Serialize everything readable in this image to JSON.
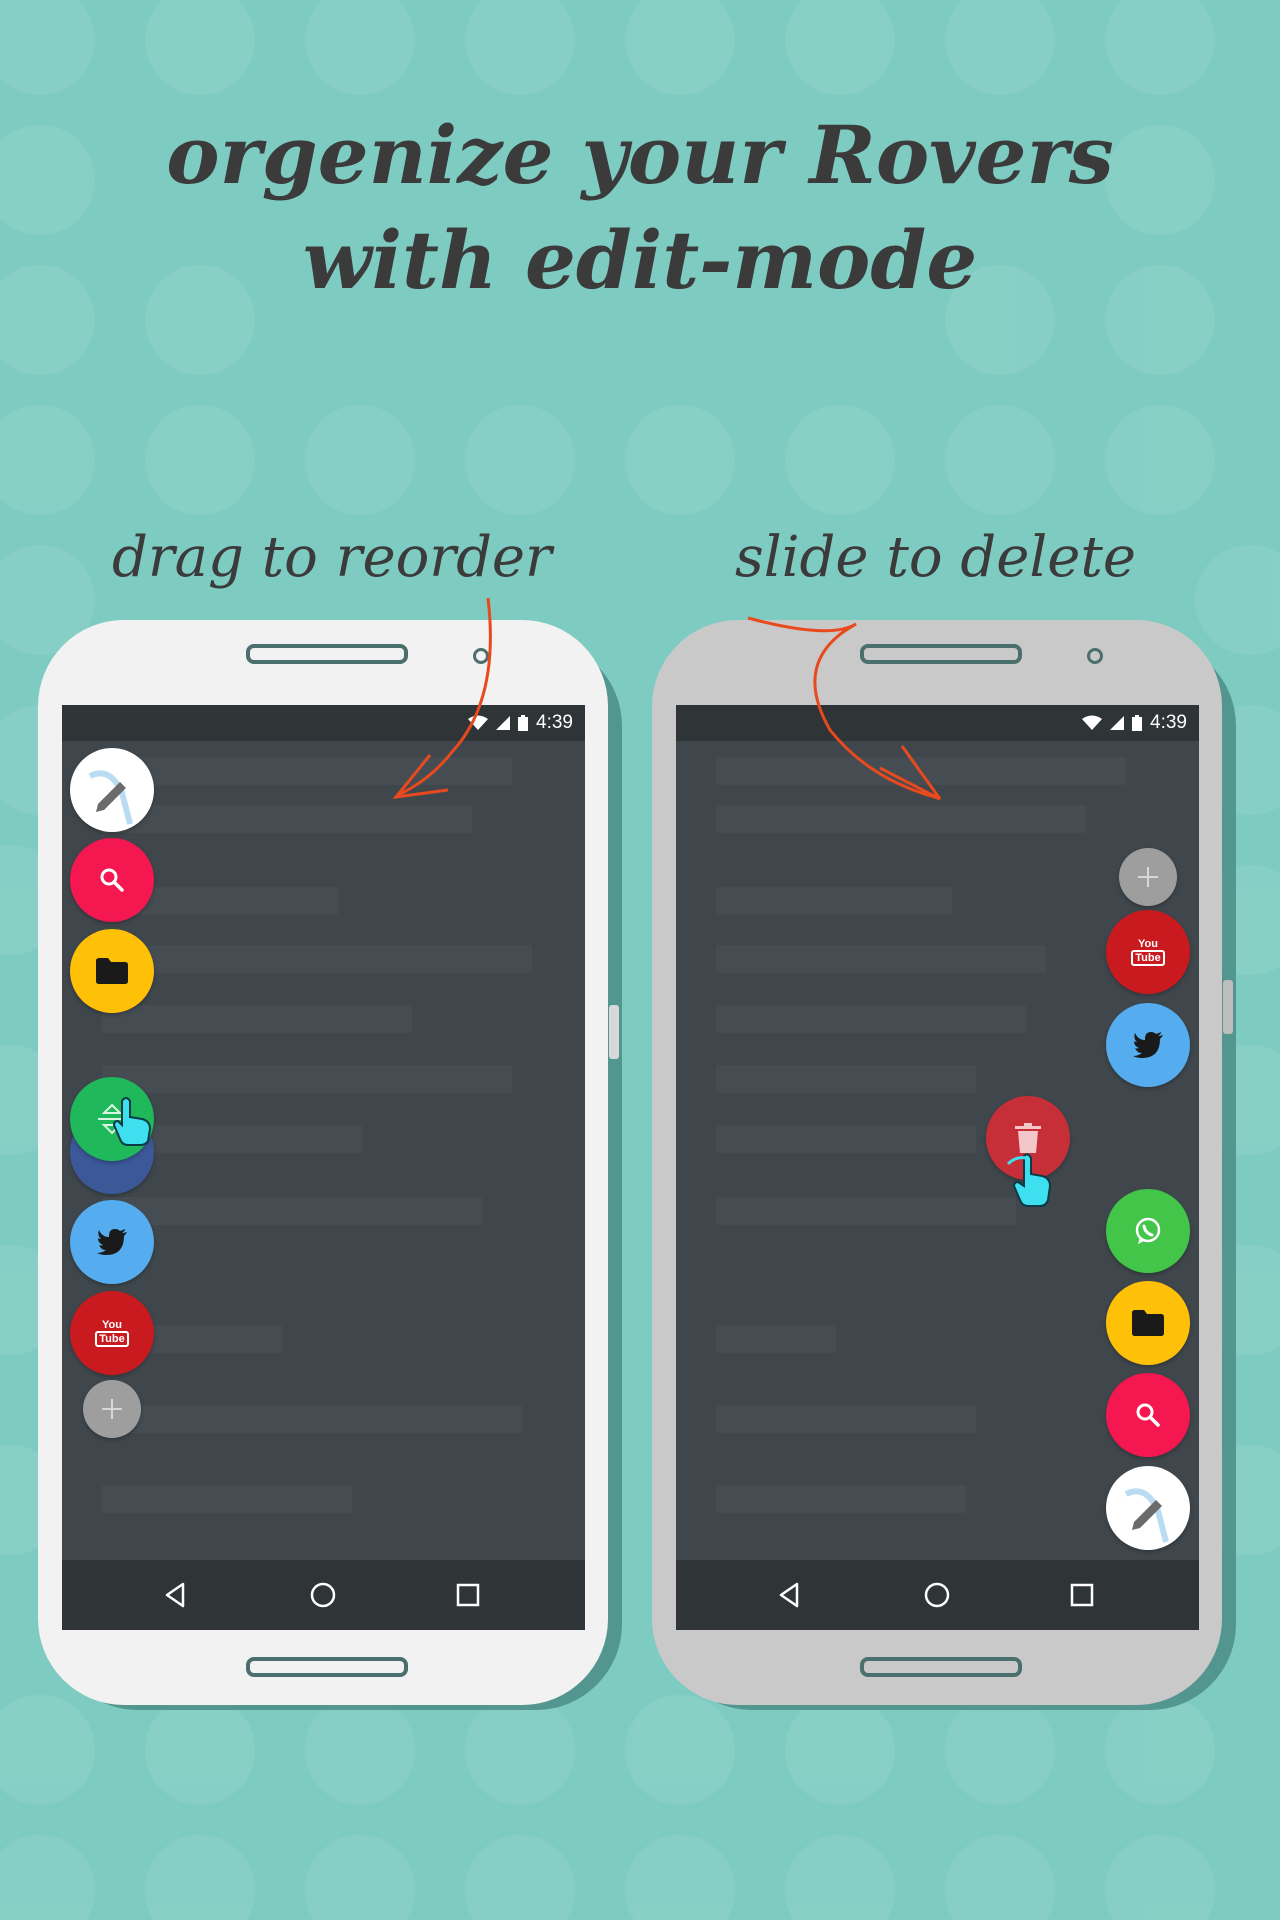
{
  "headline": {
    "line1": "orgenize your Rovers",
    "line2": "with edit-mode"
  },
  "captions": {
    "left": "drag to reorder",
    "right": "slide to delete"
  },
  "colors": {
    "background": "#7ecbc2",
    "arrow": "#e8491d",
    "screen": "#3f474d"
  },
  "phone_left": {
    "status_time": "4:39",
    "bubbles": [
      {
        "icon": "pencil-icon",
        "color": "#ffffff"
      },
      {
        "icon": "search-icon",
        "color": "#f5174f"
      },
      {
        "icon": "folder-icon",
        "color": "#ffc107"
      },
      {
        "icon": "drag-reorder-icon",
        "color": "#1fb85a"
      },
      {
        "icon": "twitter-icon",
        "color": "#55acee"
      },
      {
        "icon": "youtube-icon",
        "color": "#c91a1f"
      },
      {
        "icon": "plus-icon",
        "color": "#9e9e9e"
      }
    ],
    "nav": [
      "back-icon",
      "home-icon",
      "recents-icon"
    ]
  },
  "phone_right": {
    "status_time": "4:39",
    "bubbles": [
      {
        "icon": "plus-icon",
        "color": "#9e9e9e"
      },
      {
        "icon": "youtube-icon",
        "color": "#c91a1f"
      },
      {
        "icon": "twitter-icon",
        "color": "#55acee"
      },
      {
        "icon": "trash-icon",
        "color": "#c62f38"
      },
      {
        "icon": "whatsapp-icon",
        "color": "#43c54a"
      },
      {
        "icon": "folder-icon",
        "color": "#ffc107"
      },
      {
        "icon": "search-icon",
        "color": "#f5174f"
      },
      {
        "icon": "pencil-icon",
        "color": "#ffffff"
      }
    ],
    "nav": [
      "back-icon",
      "home-icon",
      "recents-icon"
    ]
  },
  "youtube": {
    "you": "You",
    "tube": "Tube"
  }
}
